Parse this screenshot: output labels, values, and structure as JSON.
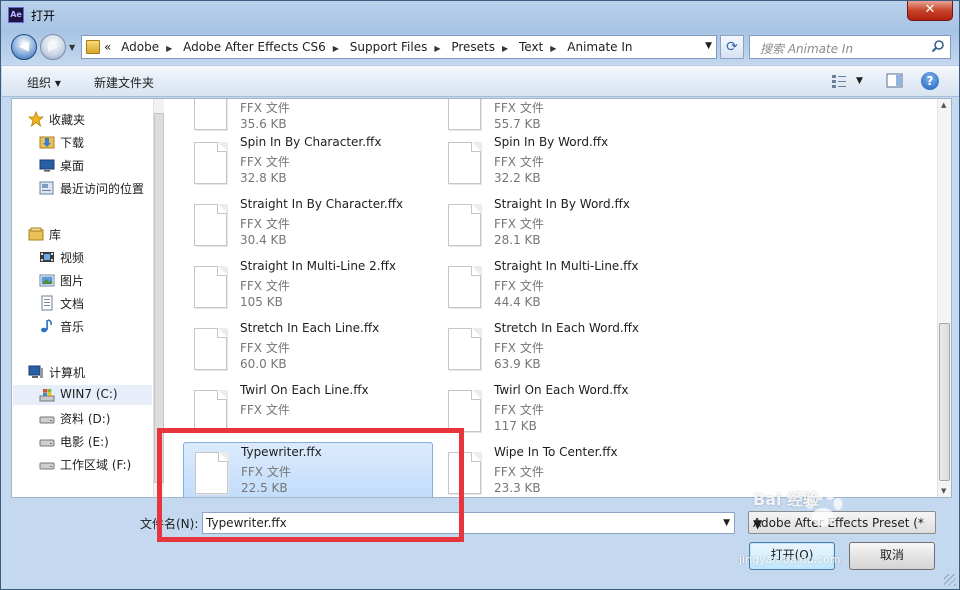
{
  "window": {
    "title": "打开",
    "app_icon": "Ae",
    "close_label": "✕"
  },
  "address": {
    "crumbs": [
      "Adobe",
      "Adobe After Effects CS6",
      "Support Files",
      "Presets",
      "Text",
      "Animate In"
    ],
    "overflow": "«"
  },
  "search": {
    "placeholder": "搜索 Animate In"
  },
  "toolbar": {
    "organize": "组织 ▾",
    "new_folder": "新建文件夹"
  },
  "sidebar": {
    "favorites": "收藏夹",
    "downloads": "下载",
    "desktop": "桌面",
    "recent": "最近访问的位置",
    "libraries": "库",
    "videos": "视频",
    "pictures": "图片",
    "documents": "文档",
    "music": "音乐",
    "computer": "计算机",
    "drive_c": "WIN7 (C:)",
    "drive_d": "资料 (D:)",
    "drive_e": "电影 (E:)",
    "drive_f": "工作区域 (F:)"
  },
  "files": [
    {
      "name": "",
      "type": "FFX 文件",
      "size": "35.6 KB"
    },
    {
      "name": "",
      "type": "FFX 文件",
      "size": "55.7 KB"
    },
    {
      "name": "Spin In By Character.ffx",
      "type": "FFX 文件",
      "size": "32.8 KB"
    },
    {
      "name": "Spin In By Word.ffx",
      "type": "FFX 文件",
      "size": "32.2 KB"
    },
    {
      "name": "Straight In By Character.ffx",
      "type": "FFX 文件",
      "size": "30.4 KB"
    },
    {
      "name": "Straight In By Word.ffx",
      "type": "FFX 文件",
      "size": "28.1 KB"
    },
    {
      "name": "Straight In Multi-Line 2.ffx",
      "type": "FFX 文件",
      "size": "105 KB"
    },
    {
      "name": "Straight In Multi-Line.ffx",
      "type": "FFX 文件",
      "size": "44.4 KB"
    },
    {
      "name": "Stretch In Each Line.ffx",
      "type": "FFX 文件",
      "size": "60.0 KB"
    },
    {
      "name": "Stretch In Each Word.ffx",
      "type": "FFX 文件",
      "size": "63.9 KB"
    },
    {
      "name": "Twirl On Each Line.ffx",
      "type": "FFX 文件",
      "size": ""
    },
    {
      "name": "Twirl On Each Word.ffx",
      "type": "FFX 文件",
      "size": "117 KB"
    },
    {
      "name": "Typewriter.ffx",
      "type": "FFX 文件",
      "size": "22.5 KB"
    },
    {
      "name": "Wipe In To Center.ffx",
      "type": "FFX 文件",
      "size": "23.3 KB"
    }
  ],
  "bottom": {
    "filename_label": "文件名(N):",
    "filename_value": "Typewriter.ffx",
    "filter": "Adobe After Effects Preset (*",
    "open": "打开(O)",
    "cancel": "取消"
  },
  "watermark": {
    "brand": "Bai 经验",
    "url": "jingyan.baidu.com"
  },
  "colors": {
    "highlight": "#e8343c",
    "selection": "#c1dcfc"
  }
}
